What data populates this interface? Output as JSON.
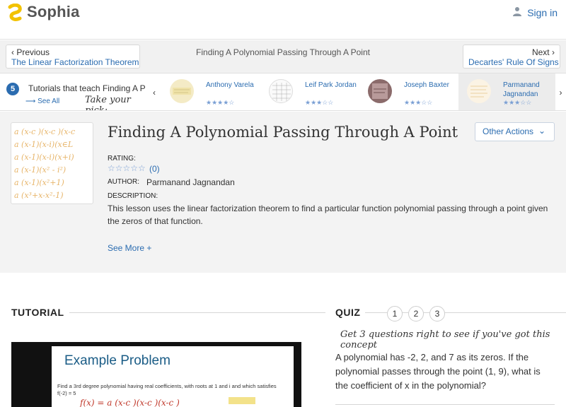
{
  "brand": {
    "name": "Sophia",
    "accent": "#2b6cb0",
    "logo_color": "#f2c200"
  },
  "signin": {
    "label": "Sign in",
    "icon": "user-icon"
  },
  "nav": {
    "prev_small": "Previous",
    "prev_link": "The Linear Factorization Theorem",
    "center": "Finding A Polynomial Passing Through A Point",
    "next_small": "Next",
    "next_link": "Decartes' Rule Of Signs"
  },
  "tutorials_strip": {
    "count": "5",
    "title": "Tutorials that teach Finding A P",
    "see_all": "See All",
    "take_pick": "Take your pick:",
    "tutors": [
      {
        "name": "Anthony Varela",
        "stars": "★★★★☆",
        "rating": 4
      },
      {
        "name": "Leif Park Jordan",
        "stars": "★★★☆☆",
        "rating": 3
      },
      {
        "name": "Joseph Baxter",
        "stars": "★★★☆☆",
        "rating": 3
      },
      {
        "name": "Parmanand Jagnandan",
        "stars": "★★★☆☆",
        "rating": 3
      }
    ]
  },
  "lesson": {
    "title": "Finding A Polynomial Passing Through A Point",
    "other_actions": "Other Actions",
    "rating_label": "RATING:",
    "rating_stars": "☆☆☆☆☆",
    "rating_count": "(0)",
    "author_label": "AUTHOR:",
    "author": "Parmanand Jagnandan",
    "description_label": "DESCRIPTION:",
    "description": "This lesson uses the linear factorization theorem to find a particular function polynomial passing through a point given the zeros of that function.",
    "see_more": "See More +"
  },
  "tutorial_section": {
    "heading": "TUTORIAL",
    "video_title": "Example Problem",
    "video_text": "Find a 3rd degree polynomial having real coefficients, with roots at 1 and i and which satisfies f(-2) = 5"
  },
  "quiz": {
    "heading": "QUIZ",
    "steps": [
      "1",
      "2",
      "3"
    ],
    "tagline": "Get 3 questions right to see if you've got this concept",
    "question": "A polynomial has -2, 2, and 7 as its zeros. If the polynomial passes through the point (1, 9), what is the coefficient of x in the polynomial?"
  }
}
